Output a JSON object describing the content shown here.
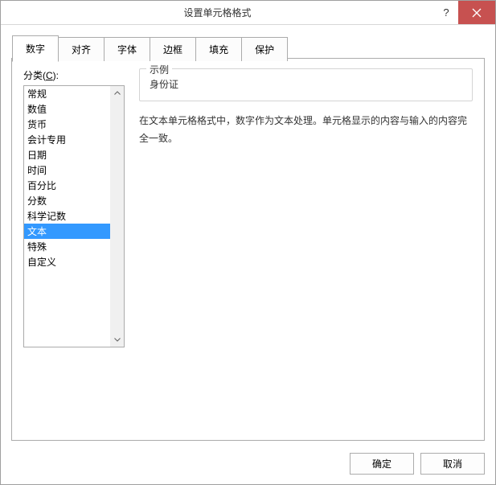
{
  "titlebar": {
    "title": "设置单元格格式",
    "help_symbol": "?",
    "close_label": "close"
  },
  "tabs": [
    {
      "label": "数字",
      "active": true
    },
    {
      "label": "对齐",
      "active": false
    },
    {
      "label": "字体",
      "active": false
    },
    {
      "label": "边框",
      "active": false
    },
    {
      "label": "填充",
      "active": false
    },
    {
      "label": "保护",
      "active": false
    }
  ],
  "category": {
    "label_prefix": "分类(",
    "label_hotkey": "C",
    "label_suffix": "):",
    "items": [
      "常规",
      "数值",
      "货币",
      "会计专用",
      "日期",
      "时间",
      "百分比",
      "分数",
      "科学记数",
      "文本",
      "特殊",
      "自定义"
    ],
    "selected_index": 9
  },
  "sample": {
    "legend": "示例",
    "value": "身份证"
  },
  "description": "在文本单元格格式中，数字作为文本处理。单元格显示的内容与输入的内容完全一致。",
  "buttons": {
    "ok": "确定",
    "cancel": "取消"
  }
}
